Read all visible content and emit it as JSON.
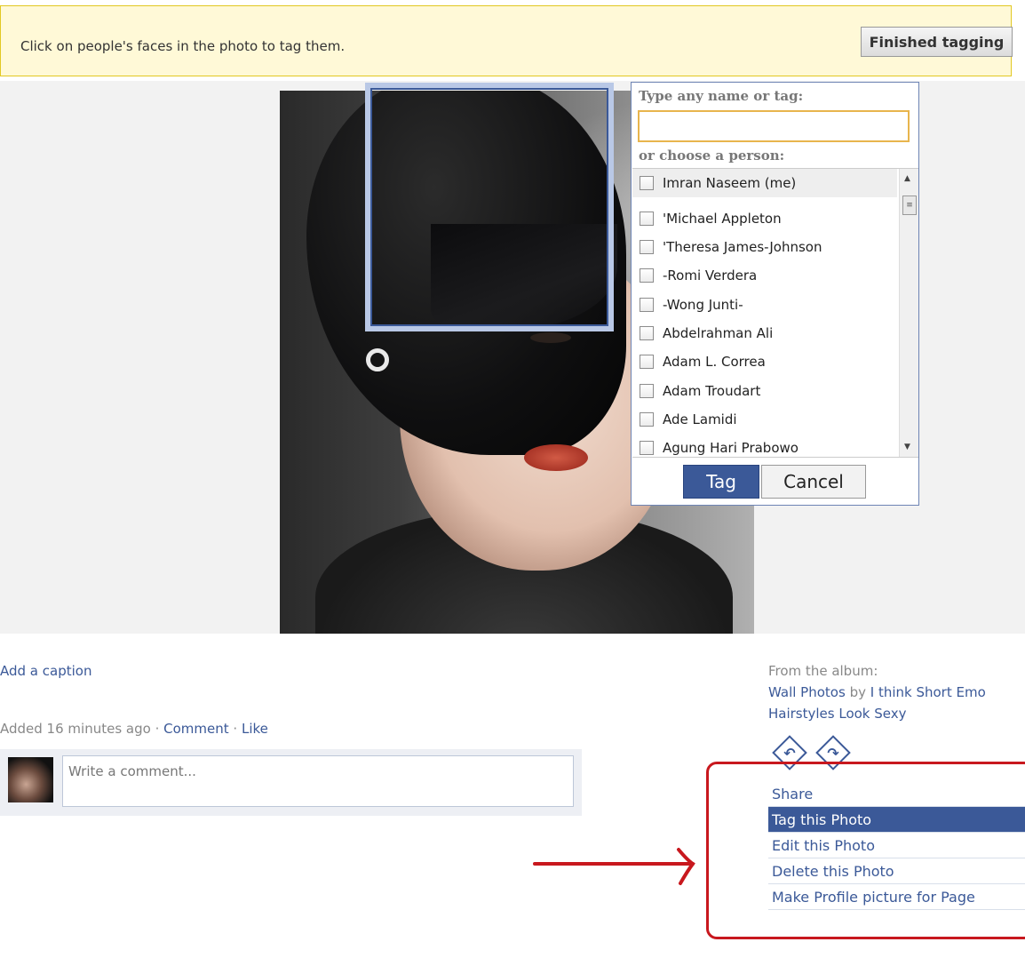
{
  "notice": {
    "text": "Click on people's faces in the photo to tag them.",
    "finished_label": "Finished tagging"
  },
  "tag_popup": {
    "name_label": "Type any name or tag:",
    "name_value": "",
    "choose_label": "or choose a person:",
    "people": [
      "Imran Naseem (me)",
      "'Michael Appleton",
      "'Theresa James-Johnson",
      "-Romi Verdera",
      "-Wong Junti-",
      "Abdelrahman Ali",
      "Adam L. Correa",
      "Adam Troudart",
      "Ade Lamidi",
      "Agung Hari Prabowo"
    ],
    "tag_label": "Tag",
    "cancel_label": "Cancel"
  },
  "photo_info": {
    "caption_link": "Add a caption",
    "added_text": "Added 16 minutes ago",
    "separator": "·",
    "comment_link": "Comment",
    "like_link": "Like",
    "comment_placeholder": "Write a comment..."
  },
  "album": {
    "from_label": "From the album:",
    "album_link": "Wall Photos",
    "by_text": "by",
    "owner_link": "I think Short Emo Hairstyles Look Sexy"
  },
  "actions": [
    "Share",
    "Tag this Photo",
    "Edit this Photo",
    "Delete this Photo",
    "Make Profile picture for Page"
  ],
  "icons": {
    "rotate_left": "rotate-left-icon",
    "rotate_right": "rotate-right-icon",
    "rotate_left_glyph": "↶",
    "rotate_right_glyph": "↷"
  },
  "colors": {
    "brand": "#3b5998",
    "notice_bg": "#fff9d7",
    "highlight_annotation": "#c8181e"
  }
}
